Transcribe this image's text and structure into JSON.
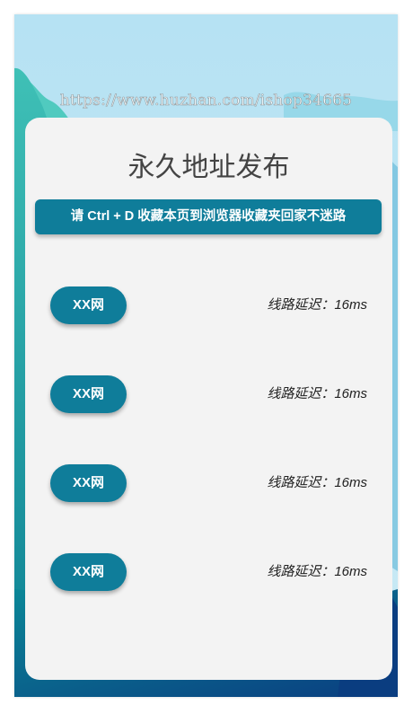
{
  "page": {
    "watermark": "https://www.huzhan.com/ishop34665",
    "title": "永久地址发布",
    "notice": "请 Ctrl + D 收藏本页到浏览器收藏夹回家不迷路"
  },
  "routes": [
    {
      "label": "XX网",
      "latency": "线路延迟：16ms"
    },
    {
      "label": "XX网",
      "latency": "线路延迟：16ms"
    },
    {
      "label": "XX网",
      "latency": "线路延迟：16ms"
    },
    {
      "label": "XX网",
      "latency": "线路延迟：16ms"
    }
  ],
  "colors": {
    "accent": "#0f7d9a",
    "card": "#f3f3f3",
    "sky": "#b6e2f3"
  }
}
